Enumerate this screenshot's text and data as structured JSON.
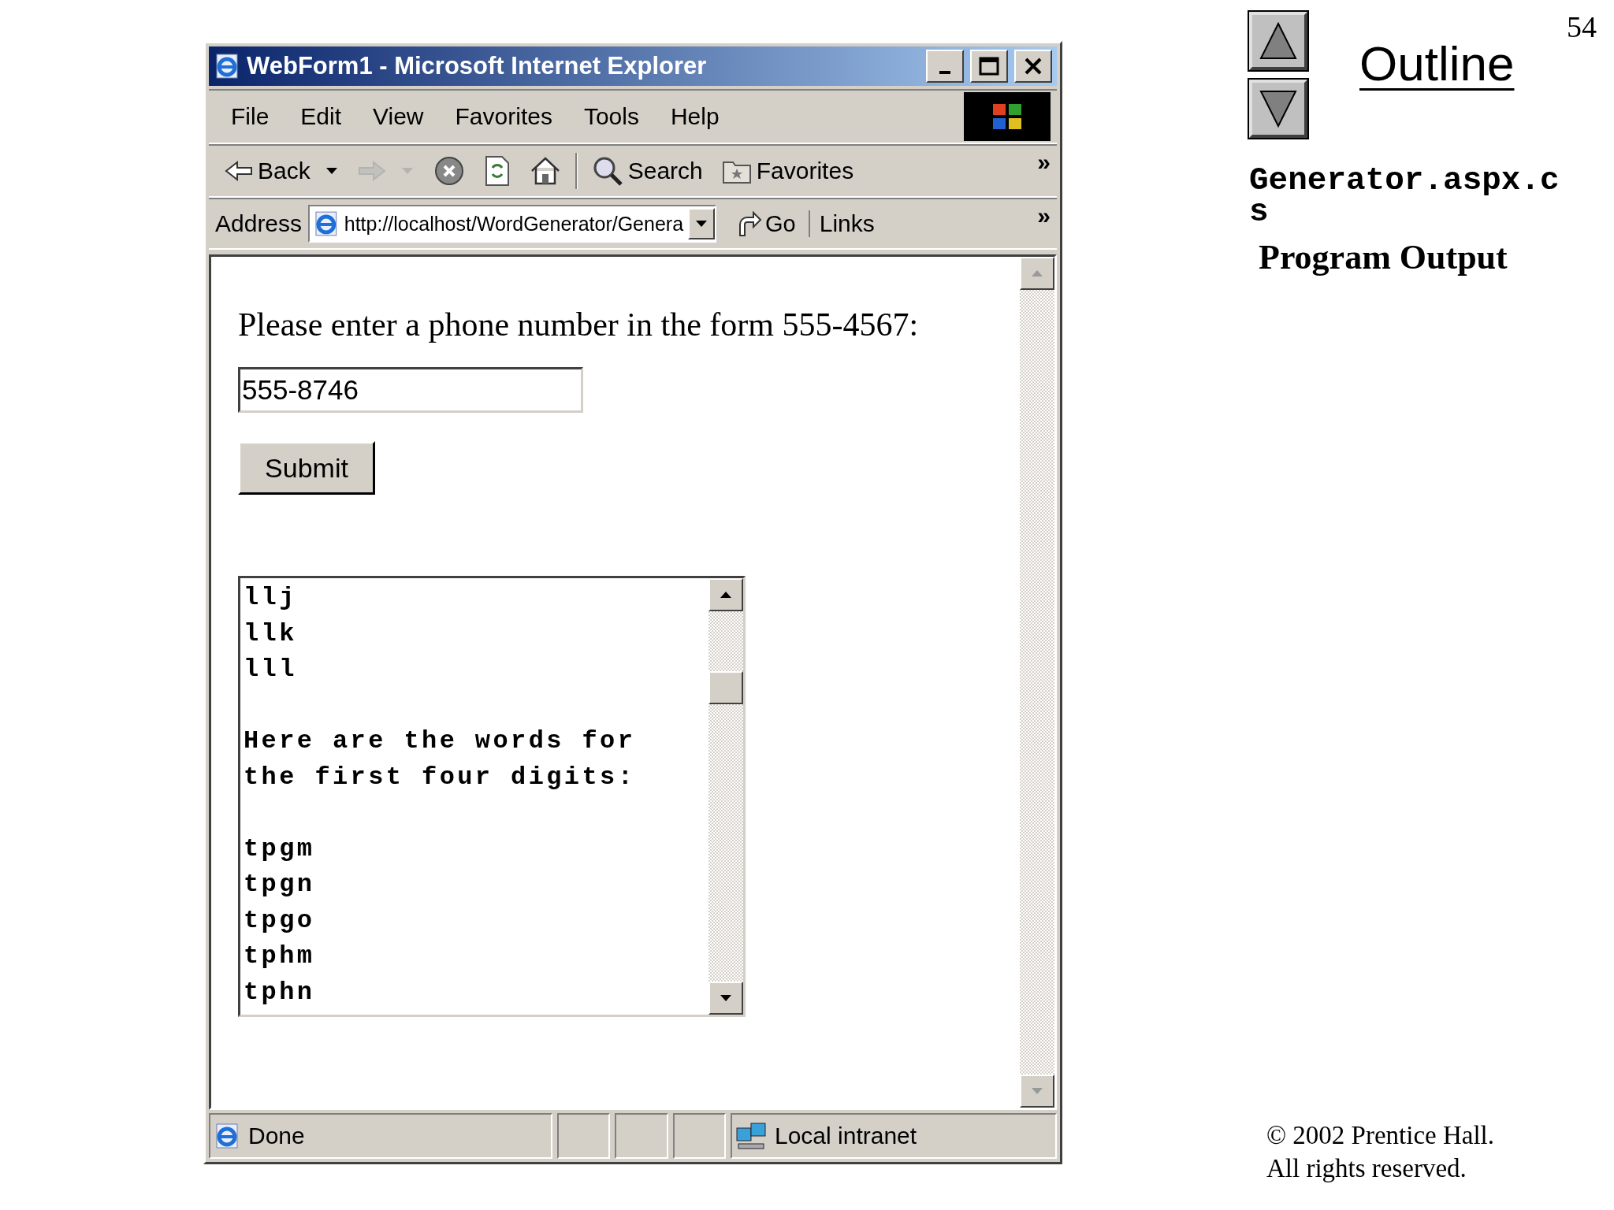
{
  "browser": {
    "title": "WebForm1 - Microsoft Internet Explorer",
    "menu": [
      "File",
      "Edit",
      "View",
      "Favorites",
      "Tools",
      "Help"
    ],
    "toolbar": [
      {
        "kind": "back",
        "label": "Back",
        "disabled": false
      },
      {
        "kind": "forward",
        "disabled": true
      },
      {
        "kind": "stop",
        "disabled": false
      },
      {
        "kind": "refresh",
        "disabled": false
      },
      {
        "kind": "home",
        "disabled": false
      },
      {
        "kind": "search",
        "label": "Search",
        "disabled": false
      },
      {
        "kind": "favorites",
        "label": "Favorites",
        "disabled": false
      }
    ],
    "toolbar_more": "»",
    "address": {
      "label": "Address",
      "value": "http://localhost/WordGenerator/Genera",
      "go": "Go",
      "links": "Links",
      "links_more": "»"
    },
    "page": {
      "prompt": "Please enter a phone number in the form 555-4567:",
      "phone": "555-8746",
      "submit": "Submit",
      "output_blocks": [
        [
          "llj",
          "llk",
          "lll"
        ],
        [
          "Here are the words for",
          "the first four digits:"
        ],
        [
          "tpgm",
          "tpgn",
          "tpgo",
          "tphm",
          "tphn"
        ]
      ]
    },
    "status": {
      "text": "Done",
      "zone": "Local intranet"
    }
  },
  "slide": {
    "number": "54",
    "outline": "Outline",
    "file": "Generator.aspx.c",
    "file_rest": "s",
    "section": "Program Output",
    "copyright": "© 2002 Prentice Hall.",
    "rights": "All rights reserved."
  }
}
